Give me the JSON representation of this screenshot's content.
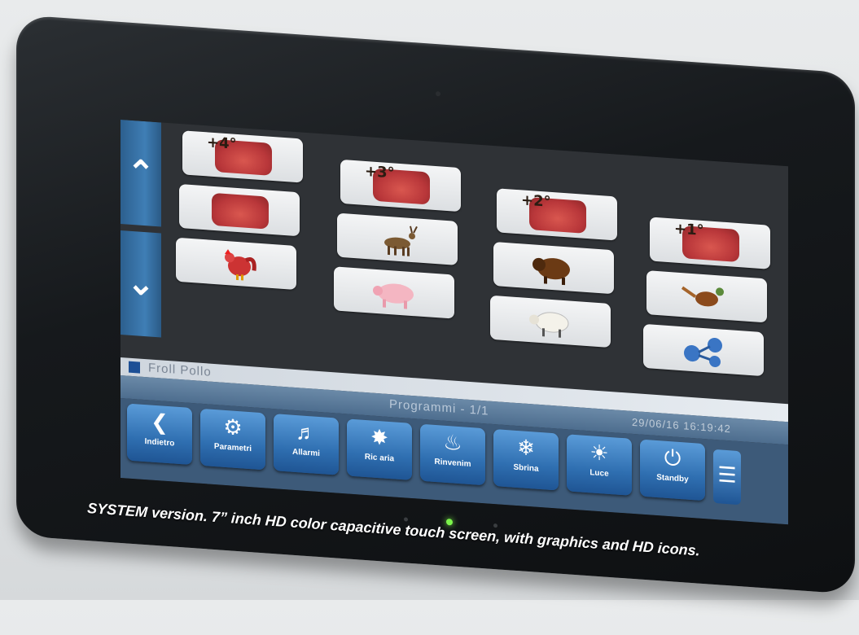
{
  "tiles": [
    {
      "temp": "+4°",
      "icon": "meat-icon"
    },
    {
      "temp": "",
      "icon": "meat-icon"
    },
    {
      "temp": "",
      "icon": "rooster-icon"
    },
    {
      "temp": "+3°",
      "icon": "meat-icon"
    },
    {
      "temp": "",
      "icon": "deer-icon"
    },
    {
      "temp": "",
      "icon": "pig-icon"
    },
    {
      "temp": "+2°",
      "icon": "meat-icon"
    },
    {
      "temp": "",
      "icon": "bison-icon"
    },
    {
      "temp": "",
      "icon": "sheep-icon"
    },
    {
      "temp": "+1°",
      "icon": "meat-icon"
    },
    {
      "temp": "",
      "icon": "pheasant-icon"
    },
    {
      "temp": "",
      "icon": "molecule-icon"
    }
  ],
  "status": {
    "label": "Froll Pollo"
  },
  "info": {
    "center": "Programmi - 1/1",
    "datetime": "29/06/16 16:19:42"
  },
  "toolbar": {
    "back": "Indietro",
    "params": "Parametri",
    "alarms": "Allarmi",
    "air": "Ric aria",
    "reheat": "Rinvenim",
    "defrost": "Sbrina",
    "light": "Luce",
    "standby": "Standby"
  },
  "caption": "SYSTEM version.  7” inch HD color capacitive touch screen, with graphics and HD icons.",
  "colors": {
    "accent": "#2f6fb1",
    "led": "#7cf54b"
  }
}
